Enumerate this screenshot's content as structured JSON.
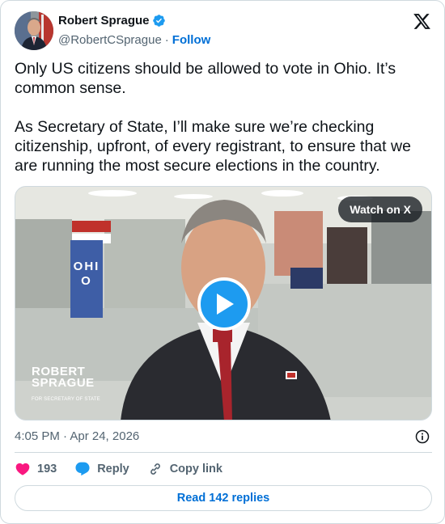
{
  "author": {
    "display_name": "Robert Sprague",
    "handle": "@RobertCSprague",
    "separator": "·",
    "follow_label": "Follow",
    "verified": true
  },
  "tweet": {
    "text": "Only US citizens should be allowed to vote in Ohio. It’s common sense.\n\nAs Secretary of State, I’ll make sure we’re checking citizenship, upfront, of every registrant, to ensure that we are running the most secure elections in the country."
  },
  "media": {
    "watch_label": "Watch on X",
    "sign_text": "OHIO",
    "brand_line1": "ROBERT",
    "brand_line2": "SPRAGUE",
    "brand_sub": "FOR SECRETARY OF STATE"
  },
  "meta": {
    "timestamp": "4:05 PM · Apr 24, 2026"
  },
  "actions": {
    "like_count": "193",
    "reply_label": "Reply",
    "copy_link_label": "Copy link",
    "read_replies_label": "Read 142 replies"
  },
  "colors": {
    "accent": "#1d9bf0",
    "link": "#006fd6",
    "like": "#f91880",
    "muted": "#536471"
  }
}
